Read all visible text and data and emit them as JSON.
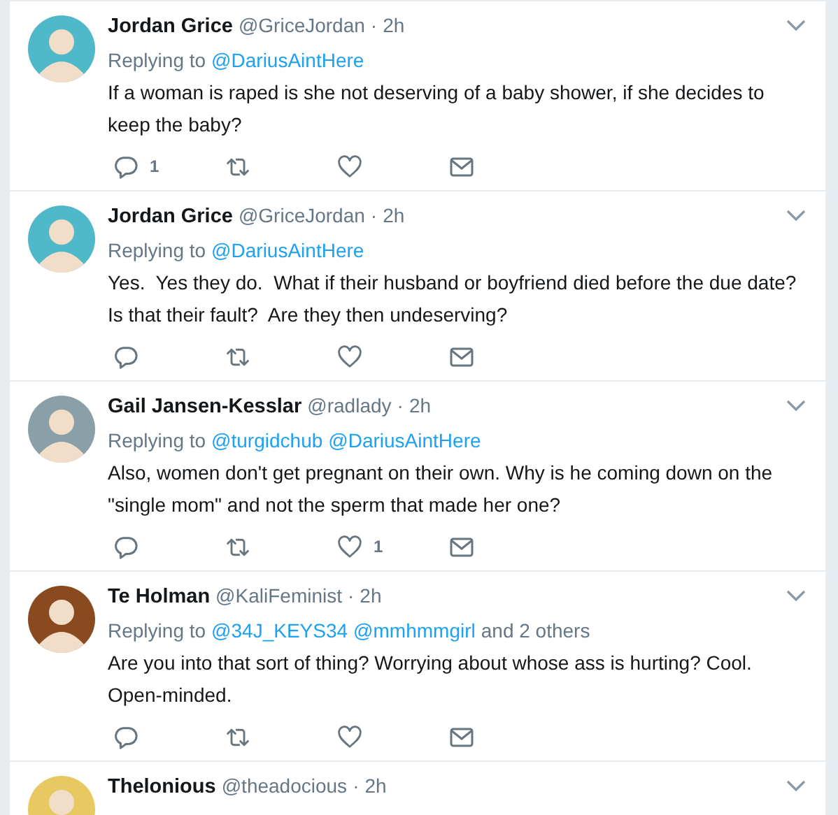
{
  "tweets": [
    {
      "name": "Jordan Grice",
      "handle": "@GriceJordan",
      "separator": "·",
      "time": "2h",
      "reply_label": "Replying to",
      "mentions": [
        "@DariusAintHere"
      ],
      "text": "If a woman is raped is she not deserving of a baby shower, if she decides to keep the baby?",
      "reply_count": "1"
    },
    {
      "name": "Jordan Grice",
      "handle": "@GriceJordan",
      "separator": "·",
      "time": "2h",
      "reply_label": "Replying to",
      "mentions": [
        "@DariusAintHere"
      ],
      "text": "Yes.  Yes they do.  What if their husband or boyfriend died before the due date? Is that their fault?  Are they then undeserving?"
    },
    {
      "name": "Gail Jansen-Kesslar",
      "handle": "@radlady",
      "separator": "·",
      "time": "2h",
      "reply_label": "Replying to",
      "mentions": [
        "@turgidchub",
        "@DariusAintHere"
      ],
      "text": "Also, women don't get pregnant on their own. Why is he coming down on the \"single mom\" and not the sperm that made her one?",
      "like_count": "1"
    },
    {
      "name": "Te Holman",
      "handle": "@KaliFeminist",
      "separator": "·",
      "time": "2h",
      "reply_label": "Replying to",
      "mentions": [
        "@34J_KEYS34",
        "@mmhmmgirl"
      ],
      "others": "and 2 others",
      "text": "Are you into that sort of thing? Worrying about whose ass is hurting? Cool. Open-minded."
    },
    {
      "name": "Thelonious",
      "handle": "@theadocious",
      "separator": "·",
      "time": "2h"
    }
  ]
}
